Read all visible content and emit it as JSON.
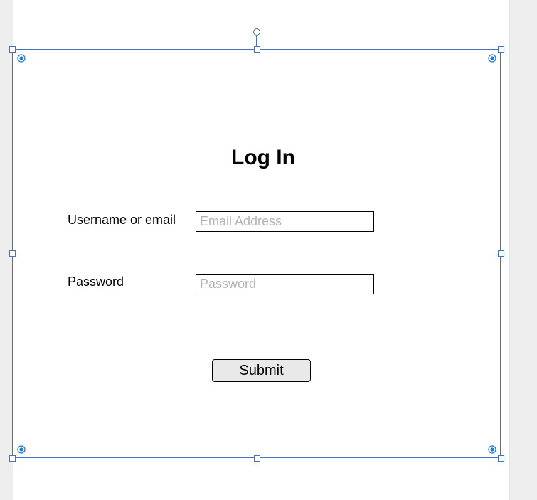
{
  "form": {
    "title": "Log In",
    "username_label": "Username or email",
    "username_placeholder": "Email Address",
    "username_value": "",
    "password_label": "Password",
    "password_placeholder": "Password",
    "password_value": "",
    "submit_label": "Submit"
  },
  "colors": {
    "selection": "#4472c4",
    "canvas_background": "#eeeeee",
    "page_background": "#ffffff",
    "placeholder_text": "#b4b4b4",
    "button_fill": "#e9e9e9"
  },
  "icons": {
    "rotate_handle": "rotate-handle-icon",
    "resize_handle": "resize-handle-icon",
    "anchor_point": "anchor-point-icon"
  }
}
